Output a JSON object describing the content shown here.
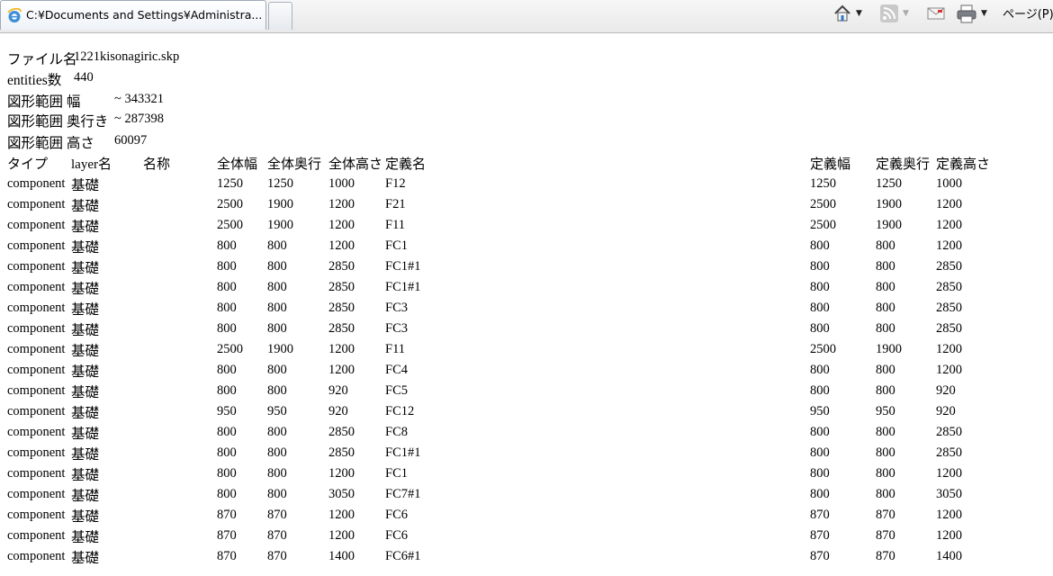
{
  "browser": {
    "tab_title": "C:¥Documents and Settings¥Administra...",
    "page_menu": "ページ(P)",
    "icons": [
      "ie-logo-icon",
      "home-icon",
      "rss-feed-icon",
      "mail-icon",
      "printer-icon"
    ]
  },
  "info": {
    "file_label": "ファイル名",
    "file_value": "1221kisonagiric.skp",
    "entities_label": "entities数",
    "entities_value": "440",
    "width_label": "図形範囲 幅",
    "width_value": "~ 343321",
    "depth_label": "図形範囲 奥行き",
    "depth_value": "~ 287398",
    "height_label": "図形範囲 高さ",
    "height_value": "60097"
  },
  "table": {
    "headers": [
      "タイプ",
      "layer名",
      "名称",
      "全体幅",
      "全体奥行",
      "全体高さ",
      "定義名",
      "",
      "定義幅",
      "定義奥行",
      "定義高さ"
    ],
    "rows": [
      [
        "component",
        "基礎",
        "",
        "1250",
        "1250",
        "1000",
        "F12",
        "",
        "1250",
        "1250",
        "1000"
      ],
      [
        "component",
        "基礎",
        "",
        "2500",
        "1900",
        "1200",
        "F21",
        "",
        "2500",
        "1900",
        "1200"
      ],
      [
        "component",
        "基礎",
        "",
        "2500",
        "1900",
        "1200",
        "F11",
        "",
        "2500",
        "1900",
        "1200"
      ],
      [
        "component",
        "基礎",
        "",
        "800",
        "800",
        "1200",
        "FC1",
        "",
        "800",
        "800",
        "1200"
      ],
      [
        "component",
        "基礎",
        "",
        "800",
        "800",
        "2850",
        "FC1#1",
        "",
        "800",
        "800",
        "2850"
      ],
      [
        "component",
        "基礎",
        "",
        "800",
        "800",
        "2850",
        "FC1#1",
        "",
        "800",
        "800",
        "2850"
      ],
      [
        "component",
        "基礎",
        "",
        "800",
        "800",
        "2850",
        "FC3",
        "",
        "800",
        "800",
        "2850"
      ],
      [
        "component",
        "基礎",
        "",
        "800",
        "800",
        "2850",
        "FC3",
        "",
        "800",
        "800",
        "2850"
      ],
      [
        "component",
        "基礎",
        "",
        "2500",
        "1900",
        "1200",
        "F11",
        "",
        "2500",
        "1900",
        "1200"
      ],
      [
        "component",
        "基礎",
        "",
        "800",
        "800",
        "1200",
        "FC4",
        "",
        "800",
        "800",
        "1200"
      ],
      [
        "component",
        "基礎",
        "",
        "800",
        "800",
        "920",
        "FC5",
        "",
        "800",
        "800",
        "920"
      ],
      [
        "component",
        "基礎",
        "",
        "950",
        "950",
        "920",
        "FC12",
        "",
        "950",
        "950",
        "920"
      ],
      [
        "component",
        "基礎",
        "",
        "800",
        "800",
        "2850",
        "FC8",
        "",
        "800",
        "800",
        "2850"
      ],
      [
        "component",
        "基礎",
        "",
        "800",
        "800",
        "2850",
        "FC1#1",
        "",
        "800",
        "800",
        "2850"
      ],
      [
        "component",
        "基礎",
        "",
        "800",
        "800",
        "1200",
        "FC1",
        "",
        "800",
        "800",
        "1200"
      ],
      [
        "component",
        "基礎",
        "",
        "800",
        "800",
        "3050",
        "FC7#1",
        "",
        "800",
        "800",
        "3050"
      ],
      [
        "component",
        "基礎",
        "",
        "870",
        "870",
        "1200",
        "FC6",
        "",
        "870",
        "870",
        "1200"
      ],
      [
        "component",
        "基礎",
        "",
        "870",
        "870",
        "1200",
        "FC6",
        "",
        "870",
        "870",
        "1200"
      ],
      [
        "component",
        "基礎",
        "",
        "870",
        "870",
        "1400",
        "FC6#1",
        "",
        "870",
        "870",
        "1400"
      ]
    ]
  }
}
